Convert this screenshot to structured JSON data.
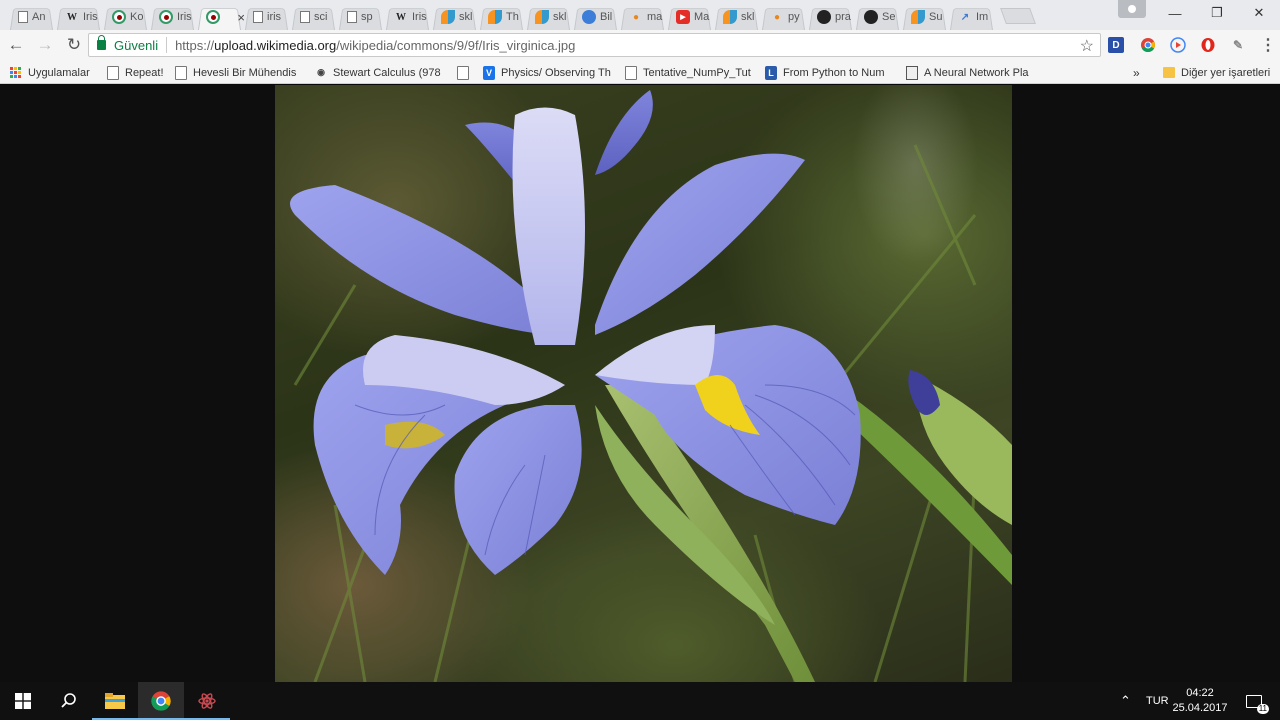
{
  "tabs": [
    {
      "title": "An",
      "icon": "page-icon"
    },
    {
      "title": "Iris",
      "icon": "wikipedia-icon"
    },
    {
      "title": "Ko",
      "icon": "wikimedia-icon"
    },
    {
      "title": "Iris",
      "icon": "wikimedia-icon"
    },
    {
      "title": "",
      "icon": "wikimedia-icon",
      "active": true
    },
    {
      "title": "iris",
      "icon": "page-icon"
    },
    {
      "title": "sci",
      "icon": "page-icon"
    },
    {
      "title": "sp",
      "icon": "page-icon"
    },
    {
      "title": "Iris",
      "icon": "wikipedia-icon"
    },
    {
      "title": "skl",
      "icon": "scikit-icon"
    },
    {
      "title": "Th",
      "icon": "scikit-icon"
    },
    {
      "title": "skl",
      "icon": "scikit-icon"
    },
    {
      "title": "Bil",
      "icon": "globe-icon"
    },
    {
      "title": "ma",
      "icon": "matplotlib-icon"
    },
    {
      "title": "Ma",
      "icon": "youtube-icon"
    },
    {
      "title": "skl",
      "icon": "scikit-icon"
    },
    {
      "title": "py",
      "icon": "matplotlib-icon"
    },
    {
      "title": "pra",
      "icon": "github-icon"
    },
    {
      "title": "Se",
      "icon": "github-icon"
    },
    {
      "title": "Su",
      "icon": "scikit-icon"
    },
    {
      "title": "Im",
      "icon": "chart-icon"
    }
  ],
  "toolbar": {
    "secure_label": "Güvenli",
    "url_scheme": "https://",
    "url_host": "upload.wikimedia.org",
    "url_path": "/wikipedia/commons/9/9f/Iris_virginica.jpg"
  },
  "bookmarks": {
    "apps_label": "Uygulamalar",
    "items": [
      {
        "label": "Repeat!",
        "icon": "page-icon"
      },
      {
        "label": "Hevesli Bir Mühendis",
        "icon": "page-icon"
      },
      {
        "label": "Stewart Calculus (978",
        "icon": "calculus-icon"
      },
      {
        "label": "",
        "icon": "page-icon"
      },
      {
        "label": "Physics/ Observing Th",
        "icon": "v-icon"
      },
      {
        "label": "Tentative_NumPy_Tut",
        "icon": "page-icon"
      },
      {
        "label": "From Python to Num",
        "icon": "l-icon"
      },
      {
        "label": "A Neural Network Pla",
        "icon": "network-icon"
      }
    ],
    "overflow_label": "»",
    "other_label": "Diğer yer işaretleri"
  },
  "taskbar": {
    "language": "TUR",
    "time": "04:22",
    "date": "25.04.2017",
    "notification_count": "11"
  },
  "colors": {
    "secure_green": "#0b8043",
    "taskbar_accent": "#76b9ed",
    "iris_petal": "#8f95e0"
  }
}
